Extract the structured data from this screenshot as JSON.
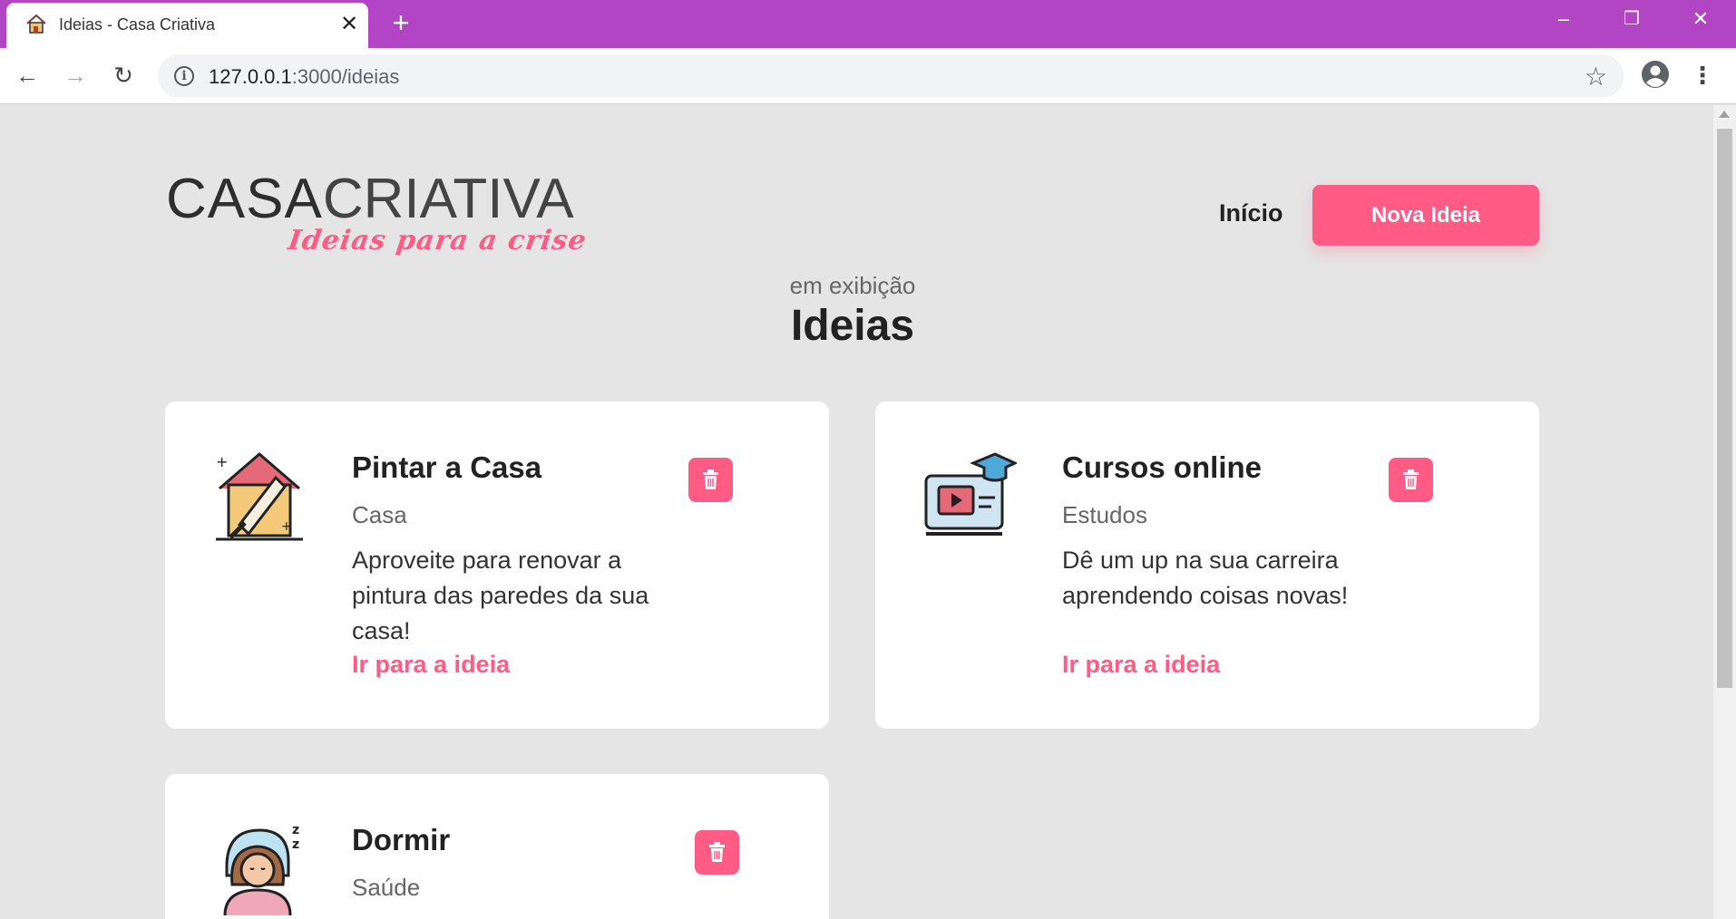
{
  "browser": {
    "tab_title": "Ideias - Casa Criativa",
    "tab_close": "✕",
    "new_tab": "+",
    "minimize": "–",
    "restore": "❐",
    "close": "✕",
    "back": "←",
    "forward": "→",
    "reload": "↻",
    "url_host": "127.0.0.1",
    "url_path": ":3000/ideias",
    "star": "☆",
    "menu": "⋮"
  },
  "header": {
    "logo_bold": "CASA",
    "logo_light": "CRIATIVA",
    "logo_tagline": "Ideias para a crise",
    "nav_inicio": "Início",
    "nova_ideia": "Nova Ideia"
  },
  "main": {
    "subtitle": "em exibição",
    "title": "Ideias"
  },
  "ideas": [
    {
      "title": "Pintar a Casa",
      "category": "Casa",
      "description": "Aproveite para renovar a pintura das paredes da sua casa!",
      "link": "Ir para a ideia",
      "icon": "house-paint-icon"
    },
    {
      "title": "Cursos online",
      "category": "Estudos",
      "description": "Dê um up na sua carreira aprendendo coisas novas!",
      "link": "Ir para a ideia",
      "icon": "online-course-icon"
    },
    {
      "title": "Dormir",
      "category": "Saúde",
      "description": "",
      "link": "",
      "icon": "sleeping-person-icon"
    }
  ],
  "colors": {
    "accent": "#ff5b84",
    "titlebar": "#b145c4",
    "page_bg": "#e5e5e5"
  }
}
